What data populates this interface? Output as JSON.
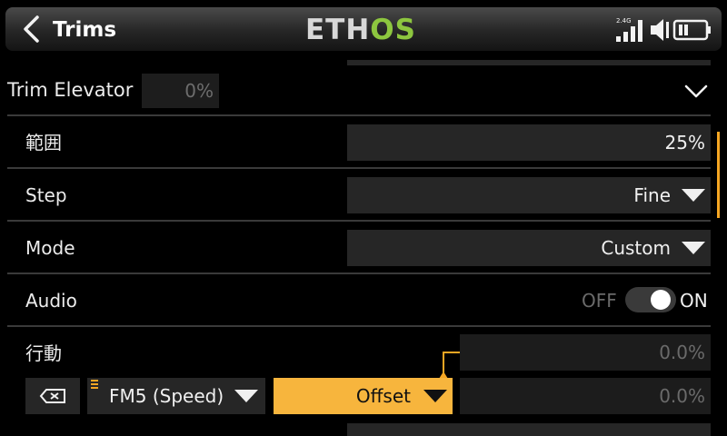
{
  "header": {
    "title": "Trims",
    "logo_left": "ETH",
    "logo_right": "OS",
    "signal_label": "2.4G"
  },
  "section": {
    "label": "Trim Elevator",
    "value": "0%"
  },
  "rows": {
    "range": {
      "label": "範囲",
      "value": "25%"
    },
    "step": {
      "label": "Step",
      "value": "Fine"
    },
    "mode": {
      "label": "Mode",
      "value": "Custom"
    },
    "audio": {
      "label": "Audio",
      "off_label": "OFF",
      "on_label": "ON",
      "state": "on"
    },
    "action": {
      "label": "行動",
      "value_1": "0.0%",
      "flight_mode": "FM5 (Speed)",
      "type": "Offset",
      "value_2": "0.0%"
    }
  },
  "colors": {
    "accent": "#f5a623",
    "logo_green": "#8dc63f",
    "field_bg": "#262626"
  },
  "icons": {
    "back": "chevron-left-icon",
    "collapse": "chevron-down-icon",
    "delete": "backspace-icon",
    "signal": "signal-bars-icon",
    "volume": "speaker-icon",
    "battery": "battery-icon"
  }
}
